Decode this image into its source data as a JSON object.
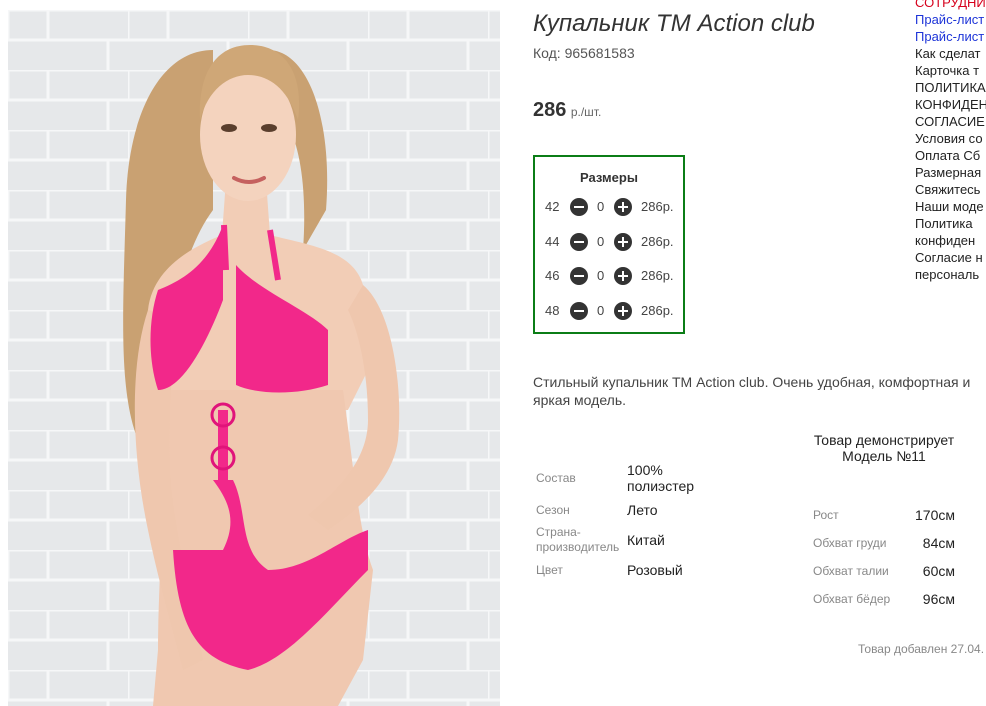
{
  "product": {
    "title": "Купальник ТМ Action club",
    "code_label": "Код:",
    "code_value": "965681583",
    "price_value": "286",
    "price_unit": "р./шт."
  },
  "sizes": {
    "title": "Размеры",
    "rows": [
      {
        "size": "42",
        "qty": "0",
        "price": "286р."
      },
      {
        "size": "44",
        "qty": "0",
        "price": "286р."
      },
      {
        "size": "46",
        "qty": "0",
        "price": "286р."
      },
      {
        "size": "48",
        "qty": "0",
        "price": "286р."
      }
    ]
  },
  "description": "Стильный купальник ТМ Action club. Очень удобная, комфортная и яркая модель.",
  "specs": [
    {
      "label": "Состав",
      "value": "100% полиэстер"
    },
    {
      "label": "Сезон",
      "value": "Лето"
    },
    {
      "label": "Страна-производитель",
      "value": "Китай"
    },
    {
      "label": "Цвет",
      "value": "Розовый"
    }
  ],
  "model": {
    "note": "Товар демонстрирует Модель №11",
    "measurements": [
      {
        "label": "Рост",
        "value": "170см"
      },
      {
        "label": "Обхват груди",
        "value": "84см"
      },
      {
        "label": "Обхват талии",
        "value": "60см"
      },
      {
        "label": "Обхват бёдер",
        "value": "96см"
      }
    ]
  },
  "added_text": "Товар добавлен 27.04.",
  "sidebar": {
    "links": [
      {
        "label": "СОТРУДНИЧ",
        "style": "red"
      },
      {
        "label": "Прайс-лист",
        "style": "blue"
      },
      {
        "label": "Прайс-лист",
        "style": "blue"
      },
      {
        "label": "Как сделат",
        "style": "plain"
      },
      {
        "label": "Карточка т",
        "style": "plain"
      },
      {
        "label": "ПОЛИТИКА",
        "style": "plain"
      },
      {
        "label": "КОНФИДЕН",
        "style": "plain"
      },
      {
        "label": "СОГЛАСИЕ",
        "style": "plain"
      },
      {
        "label": "Условия со",
        "style": "plain"
      },
      {
        "label": "Оплата Сб",
        "style": "plain"
      },
      {
        "label": "Размерная",
        "style": "plain"
      },
      {
        "label": "Свяжитесь",
        "style": "plain"
      },
      {
        "label": "Наши моде",
        "style": "plain"
      },
      {
        "label": "Политика",
        "style": "plain"
      },
      {
        "label": "конфиден",
        "style": "plain"
      },
      {
        "label": "Согласие н",
        "style": "plain"
      },
      {
        "label": "персональ",
        "style": "plain"
      }
    ]
  },
  "colors": {
    "sizes_border": "#0b7d16",
    "link_red": "#d6001c",
    "link_blue": "#1d34d8",
    "swimsuit": "#f2288a"
  },
  "icons": {
    "minus": "minus-circle-icon",
    "plus": "plus-circle-icon"
  }
}
